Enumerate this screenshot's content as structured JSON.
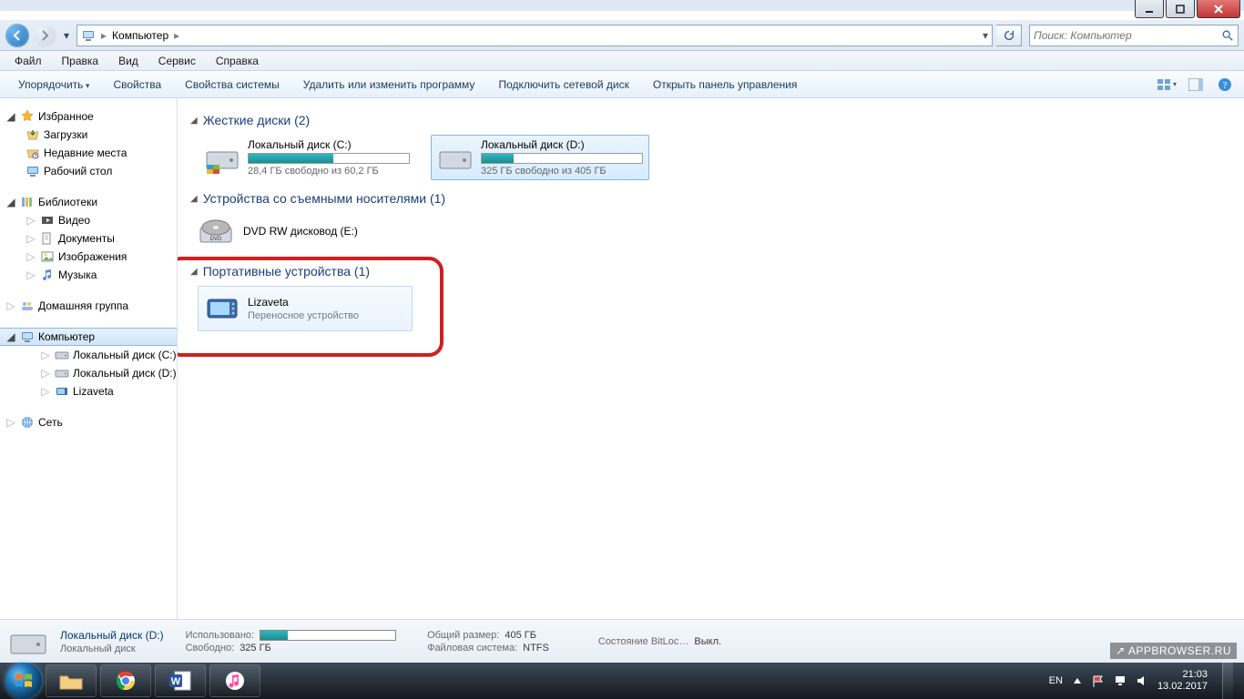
{
  "window": {
    "breadcrumb_root": "Компьютер",
    "search_placeholder": "Поиск: Компьютер"
  },
  "menubar": {
    "file": "Файл",
    "edit": "Правка",
    "view": "Вид",
    "tools": "Сервис",
    "help": "Справка"
  },
  "cmdbar": {
    "organize": "Упорядочить",
    "properties": "Свойства",
    "sys_properties": "Свойства системы",
    "uninstall": "Удалить или изменить программу",
    "map_drive": "Подключить сетевой диск",
    "control_panel": "Открыть панель управления"
  },
  "sidebar": {
    "favorites": "Избранное",
    "downloads": "Загрузки",
    "recent": "Недавние места",
    "desktop": "Рабочий стол",
    "libraries": "Библиотеки",
    "videos": "Видео",
    "documents": "Документы",
    "pictures": "Изображения",
    "music": "Музыка",
    "homegroup": "Домашняя группа",
    "computer": "Компьютер",
    "drive_c": "Локальный диск (C:)",
    "drive_d": "Локальный диск (D:)",
    "lizaveta": "Lizaveta",
    "network": "Сеть"
  },
  "content": {
    "section_hdd": "Жесткие диски (2)",
    "section_removable": "Устройства со съемными носителями (1)",
    "section_portable": "Портативные устройства (1)",
    "drive_c": {
      "name": "Локальный диск (C:)",
      "free": "28,4 ГБ свободно из 60,2 ГБ",
      "fill_pct": 53
    },
    "drive_d": {
      "name": "Локальный диск (D:)",
      "free": "325 ГБ свободно из 405 ГБ",
      "fill_pct": 20
    },
    "dvd": "DVD RW дисковод (E:)",
    "portable": {
      "name": "Lizaveta",
      "sub": "Переносное устройство"
    }
  },
  "details": {
    "title": "Локальный диск (D:)",
    "subtitle": "Локальный диск",
    "used_label": "Использовано:",
    "free_label": "Свободно:",
    "free_value": "325 ГБ",
    "size_label": "Общий размер:",
    "size_value": "405 ГБ",
    "fs_label": "Файловая система:",
    "fs_value": "NTFS",
    "bitlocker_label": "Состояние BitLoc…",
    "bitlocker_value": "Выкл.",
    "fill_pct": 20
  },
  "tray": {
    "lang": "EN",
    "time": "21:03",
    "date": "13.02.2017"
  },
  "watermark": "APPBROWSER.RU"
}
